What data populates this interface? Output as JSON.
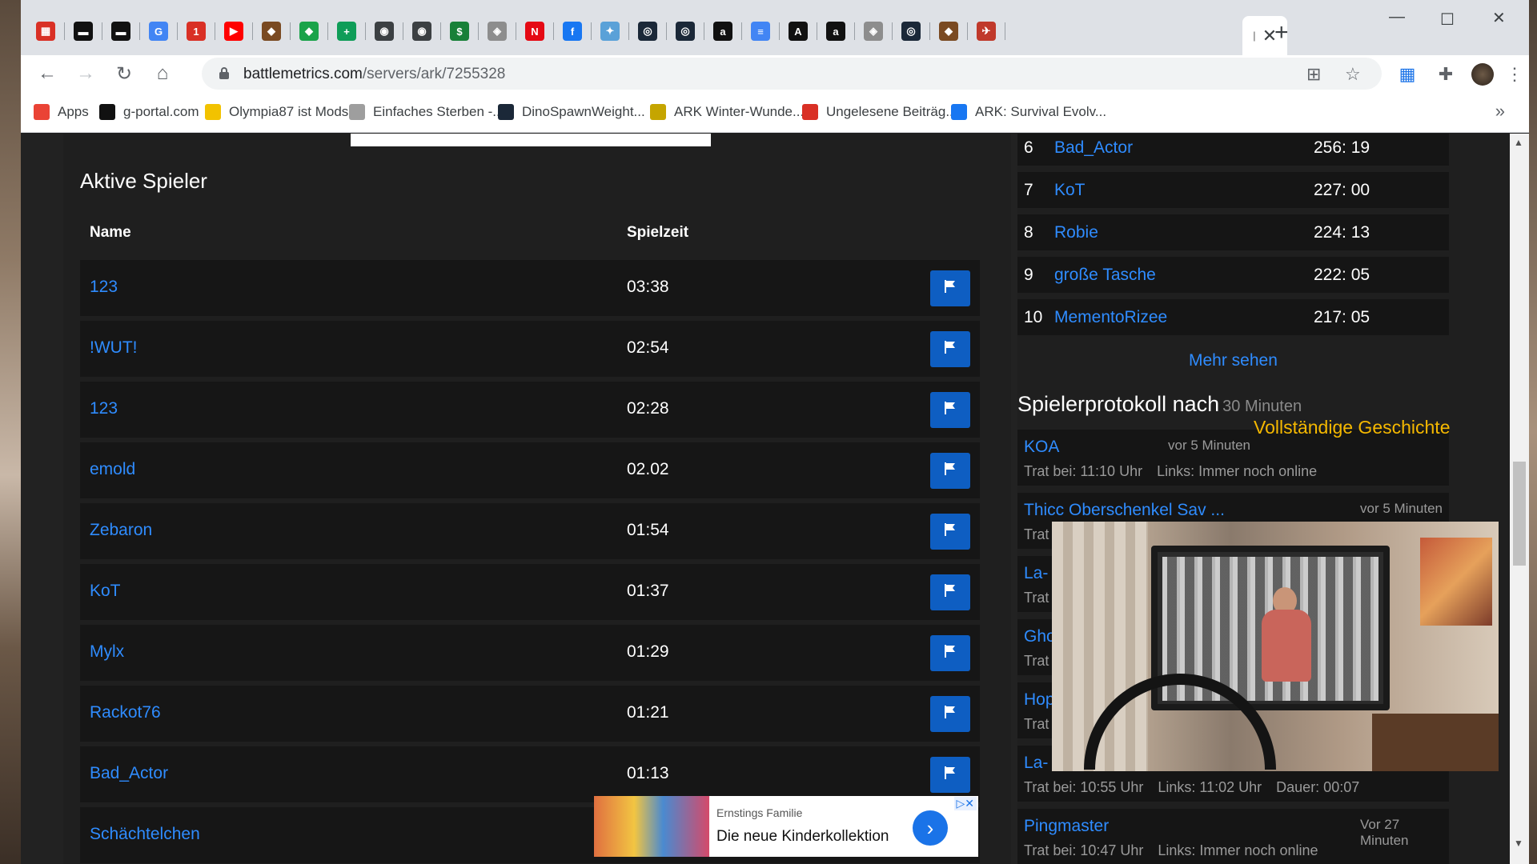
{
  "browser": {
    "tabs": [
      {
        "icon": "calendar-icon",
        "color": "#d93025",
        "glyph": "▦"
      },
      {
        "icon": "gportal-icon",
        "color": "#111111",
        "glyph": "▬"
      },
      {
        "icon": "gportal-icon",
        "color": "#111111",
        "glyph": "▬"
      },
      {
        "icon": "google-icon",
        "color": "#4285f4",
        "glyph": "G"
      },
      {
        "icon": "notification-icon",
        "color": "#d93025",
        "glyph": "1"
      },
      {
        "icon": "youtube-icon",
        "color": "#ff0000",
        "glyph": "▶"
      },
      {
        "icon": "ark-icon",
        "color": "#7a4a22",
        "glyph": "◆"
      },
      {
        "icon": "gem-icon",
        "color": "#1aa34a",
        "glyph": "◆"
      },
      {
        "icon": "plus-app-icon",
        "color": "#0f9d58",
        "glyph": "+"
      },
      {
        "icon": "dino-icon",
        "color": "#3c4043",
        "glyph": "◉"
      },
      {
        "icon": "dino-icon",
        "color": "#3c4043",
        "glyph": "◉"
      },
      {
        "icon": "money-icon",
        "color": "#188038",
        "glyph": "$"
      },
      {
        "icon": "shield-icon",
        "color": "#8d8d8d",
        "glyph": "◈"
      },
      {
        "icon": "netflix-icon",
        "color": "#e50914",
        "glyph": "N"
      },
      {
        "icon": "facebook-icon",
        "color": "#1877f2",
        "glyph": "f"
      },
      {
        "icon": "bird-icon",
        "color": "#5aa1d8",
        "glyph": "✦"
      },
      {
        "icon": "steam-icon",
        "color": "#1b2838",
        "glyph": "◎"
      },
      {
        "icon": "steam-icon",
        "color": "#1b2838",
        "glyph": "◎"
      },
      {
        "icon": "amazon-icon",
        "color": "#111111",
        "glyph": "a"
      },
      {
        "icon": "docs-icon",
        "color": "#4285f4",
        "glyph": "≡"
      },
      {
        "icon": "ark-a-icon",
        "color": "#111111",
        "glyph": "A"
      },
      {
        "icon": "amazon-icon",
        "color": "#111111",
        "glyph": "a"
      },
      {
        "icon": "shield-icon",
        "color": "#8d8d8d",
        "glyph": "◈"
      },
      {
        "icon": "steam-icon",
        "color": "#1b2838",
        "glyph": "◎"
      },
      {
        "icon": "ark-icon",
        "color": "#7a4a22",
        "glyph": "◆"
      },
      {
        "icon": "dino-red-icon",
        "color": "#c0392b",
        "glyph": "✈"
      }
    ],
    "url_host": "battlemetrics.com",
    "url_path": "/servers/ark/7255328",
    "bookmarks": [
      {
        "label": "Apps",
        "icon": "apps-grid-icon",
        "color": "#ea4335"
      },
      {
        "label": "g-portal.com",
        "icon": "gportal-icon",
        "color": "#111111"
      },
      {
        "label": "Olympia87 ist Mods",
        "icon": "trophy-icon",
        "color": "#f2c200"
      },
      {
        "label": "Einfaches Sterben -...",
        "icon": "ark-a-icon",
        "color": "#9e9e9e"
      },
      {
        "label": "DinoSpawnWeight...",
        "icon": "steam-icon",
        "color": "#1b2838"
      },
      {
        "label": "ARK Winter-Wunde...",
        "icon": "wings-icon",
        "color": "#c5a500"
      },
      {
        "label": "Ungelesene Beiträg...",
        "icon": "notification-icon",
        "color": "#d93025"
      },
      {
        "label": "ARK: Survival Evolv...",
        "icon": "facebook-icon",
        "color": "#1877f2"
      }
    ]
  },
  "players": {
    "heading": "Aktive Spieler",
    "col_name": "Name",
    "col_time": "Spielzeit",
    "rows": [
      {
        "name": "123",
        "time": "03:38"
      },
      {
        "name": "!WUT!",
        "time": "02:54"
      },
      {
        "name": "123",
        "time": "02:28"
      },
      {
        "name": "emold",
        "time": "02.02"
      },
      {
        "name": "Zebaron",
        "time": "01:54"
      },
      {
        "name": "KoT",
        "time": "01:37"
      },
      {
        "name": "Mylx",
        "time": "01:29"
      },
      {
        "name": "Rackot76",
        "time": "01:21"
      },
      {
        "name": "Bad_Actor",
        "time": "01:13"
      },
      {
        "name": "Schächtelchen",
        "time": ""
      }
    ]
  },
  "top_players": [
    {
      "rank": "6",
      "name": "Bad_Actor",
      "time": "256: 19"
    },
    {
      "rank": "7",
      "name": "KoT",
      "time": "227: 00"
    },
    {
      "rank": "8",
      "name": "Robie",
      "time": "224: 13"
    },
    {
      "rank": "9",
      "name": "große Tasche",
      "time": "222: 05"
    },
    {
      "rank": "10",
      "name": "MementoRizee",
      "time": "217: 05"
    }
  ],
  "more_link": "Mehr sehen",
  "log": {
    "heading": "Spielerprotokoll nach",
    "subheading": "30 Minuten",
    "full_history": "Vollständige Geschichte",
    "entries": [
      {
        "name": "KOA",
        "ago": "vor 5 Minuten",
        "joined": "Trat bei: 11:10 Uhr",
        "left": "Links: Immer noch online",
        "duration": ""
      },
      {
        "name": "Thicc Oberschenkel Sav ...",
        "ago": "vor 5 Minuten",
        "joined": "Trat",
        "left": "",
        "duration": ""
      },
      {
        "name": "La-",
        "ago": "",
        "joined": "Trat",
        "left": "",
        "duration": ""
      },
      {
        "name": "Gho",
        "ago": "",
        "joined": "Trat",
        "left": "",
        "duration": ""
      },
      {
        "name": "Hop",
        "ago": "",
        "joined": "Trat",
        "left": "",
        "duration": ""
      },
      {
        "name": "La-",
        "ago": "",
        "joined": "Trat bei: 10:55 Uhr",
        "left": "Links: 11:02 Uhr",
        "duration": "Dauer: 00:07"
      },
      {
        "name": "Pingmaster",
        "ago": "Vor 27 Minuten",
        "joined": "Trat bei: 10:47 Uhr",
        "left": "Links: Immer noch online",
        "duration": ""
      }
    ]
  },
  "ad": {
    "brand": "Ernstings Familie",
    "title": "Die neue Kinderkollektion"
  }
}
